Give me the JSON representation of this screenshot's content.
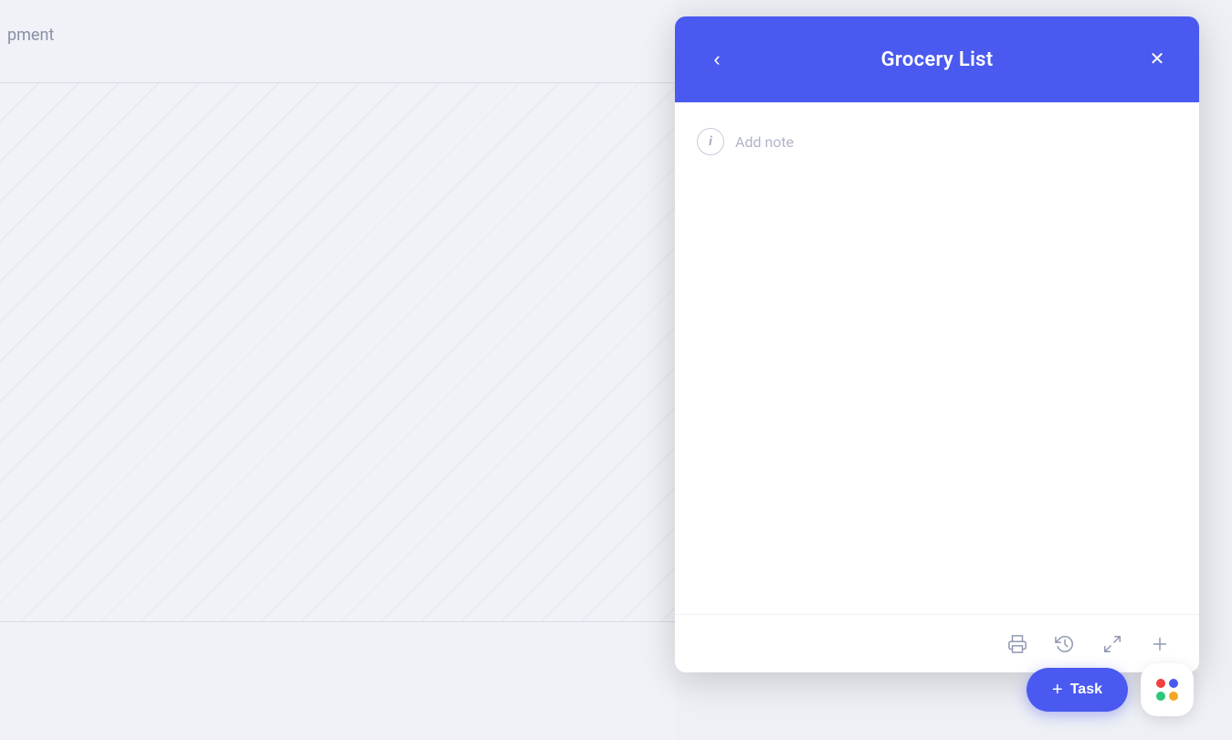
{
  "background": {
    "text": "pment"
  },
  "panel": {
    "title": "Grocery List",
    "back_label": "‹",
    "close_label": "✕",
    "add_note_placeholder": "Add note"
  },
  "footer": {
    "icons": [
      "print",
      "history",
      "expand",
      "add"
    ]
  },
  "floating": {
    "task_label": "Task",
    "task_plus": "+"
  }
}
